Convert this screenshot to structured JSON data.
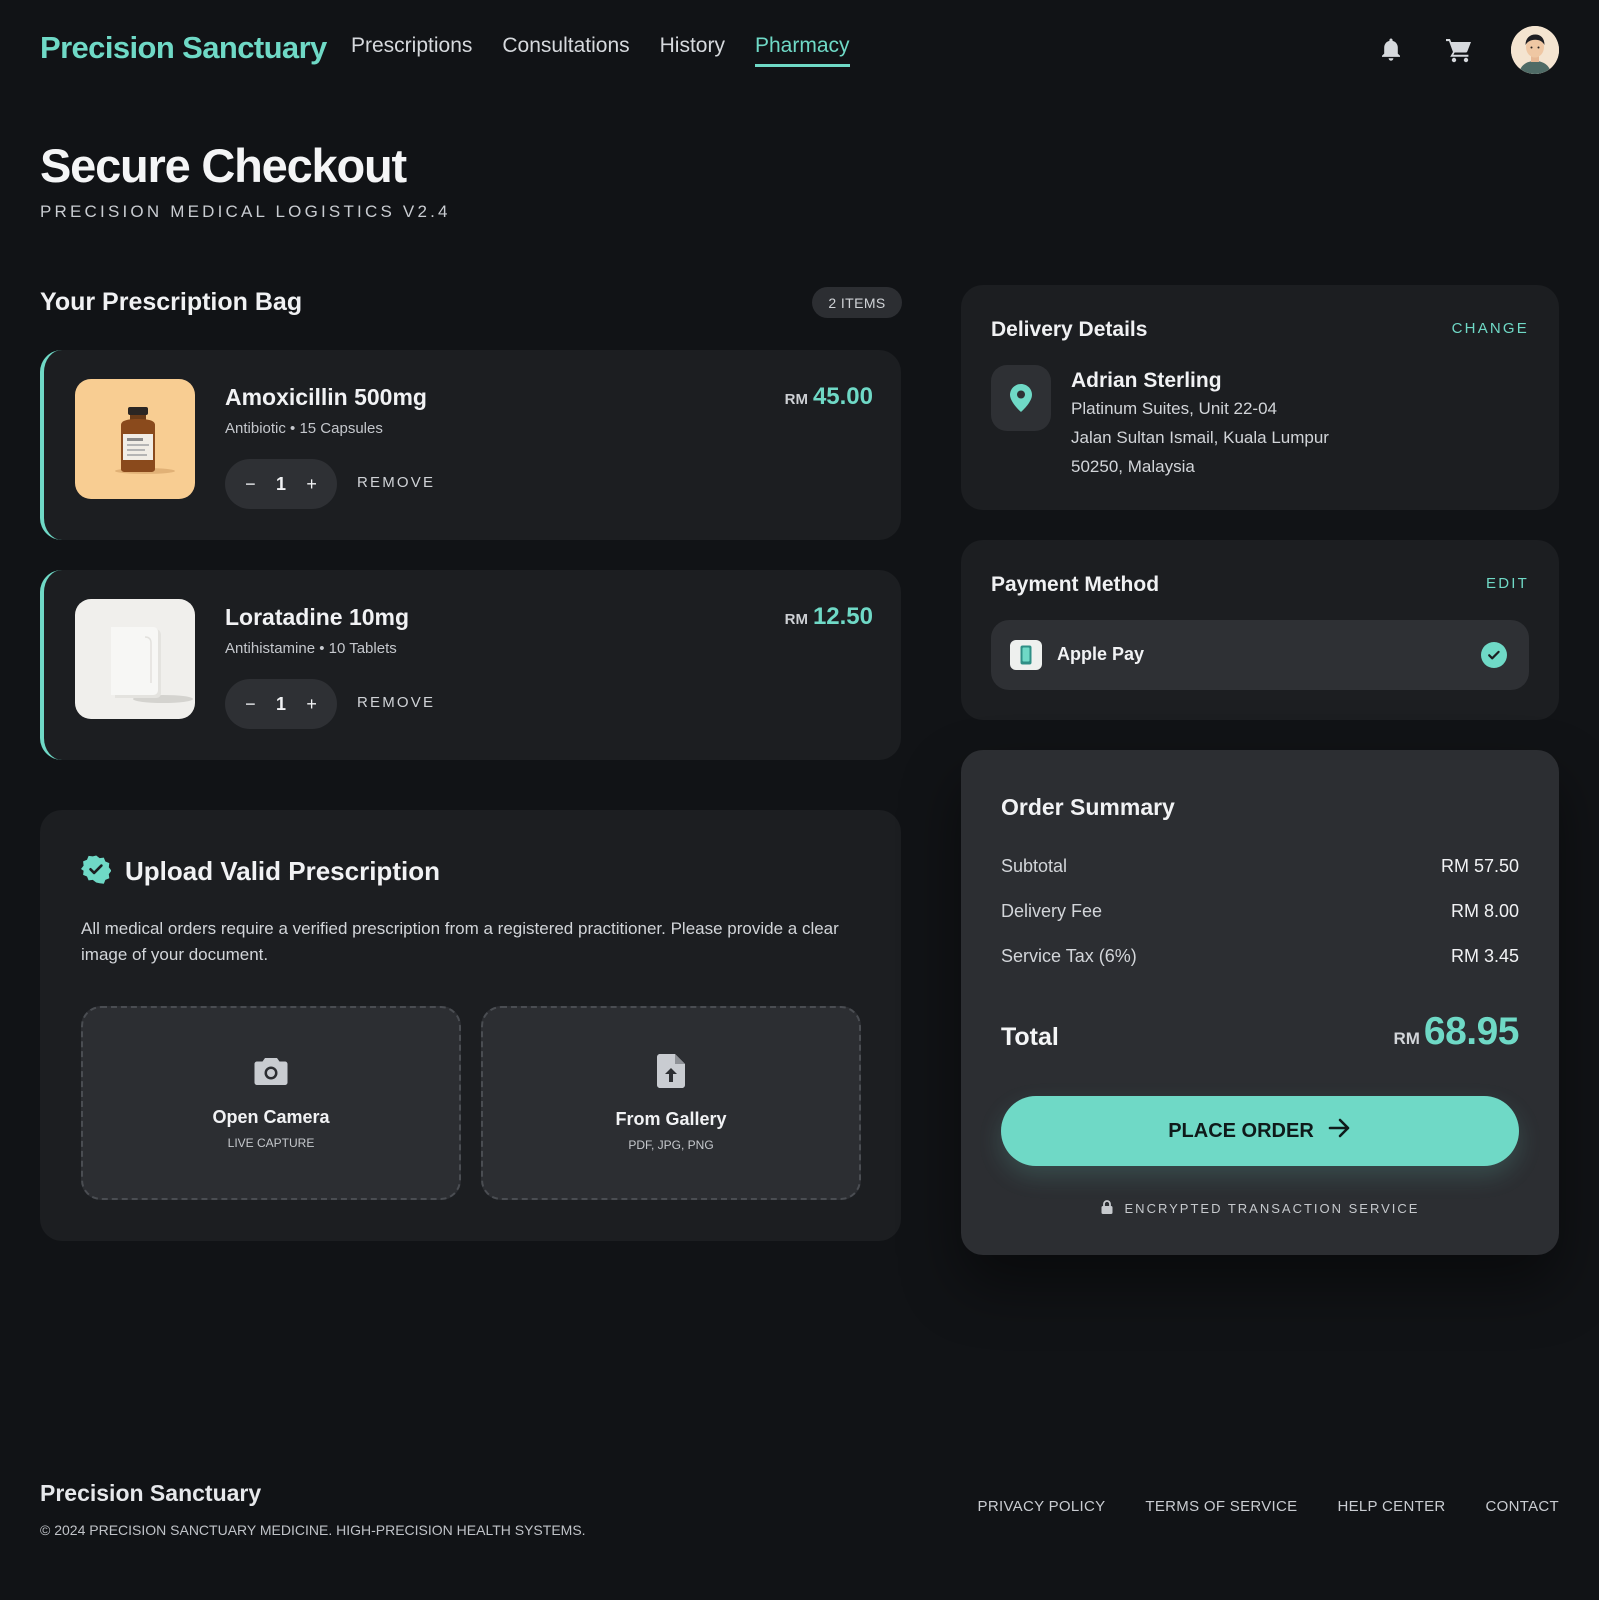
{
  "header": {
    "brand": "Precision Sanctuary",
    "nav": [
      {
        "label": "Prescriptions"
      },
      {
        "label": "Consultations"
      },
      {
        "label": "History"
      },
      {
        "label": "Pharmacy",
        "active": true
      }
    ],
    "icons": [
      "bell-icon",
      "cart-icon",
      "avatar"
    ]
  },
  "page": {
    "title": "Secure Checkout",
    "subtitle": "PRECISION MEDICAL LOGISTICS V2.4"
  },
  "bag": {
    "title": "Your Prescription Bag",
    "count_label": "2 ITEMS",
    "items": [
      {
        "name": "Amoxicillin 500mg",
        "meta": "Antibiotic • 15 Capsules",
        "currency": "RM",
        "price": "45.00",
        "qty": "1",
        "remove_label": "REMOVE",
        "minus": "−",
        "plus": "+"
      },
      {
        "name": "Loratadine 10mg",
        "meta": "Antihistamine • 10 Tablets",
        "currency": "RM",
        "price": "12.50",
        "qty": "1",
        "remove_label": "REMOVE",
        "minus": "−",
        "plus": "+"
      }
    ]
  },
  "upload": {
    "title": "Upload Valid Prescription",
    "description": "All medical orders require a verified prescription from a registered practitioner. Please provide a clear image of your document.",
    "options": [
      {
        "label": "Open Camera",
        "sub": "LIVE CAPTURE",
        "icon": "camera-icon"
      },
      {
        "label": "From Gallery",
        "sub": "PDF, JPG, PNG",
        "icon": "file-upload-icon"
      }
    ]
  },
  "delivery": {
    "title": "Delivery Details",
    "action": "CHANGE",
    "name": "Adrian Sterling",
    "lines": [
      "Platinum Suites, Unit 22-04",
      "Jalan Sultan Ismail, Kuala Lumpur",
      "50250, Malaysia"
    ]
  },
  "payment": {
    "title": "Payment Method",
    "action": "EDIT",
    "method": "Apple Pay"
  },
  "summary": {
    "title": "Order Summary",
    "rows": [
      {
        "label": "Subtotal",
        "value": "RM 57.50"
      },
      {
        "label": "Delivery Fee",
        "value": "RM 8.00"
      },
      {
        "label": "Service Tax (6%)",
        "value": "RM 3.45"
      }
    ],
    "total_label": "Total",
    "total_currency": "RM",
    "total_value": "68.95",
    "cta": "PLACE ORDER",
    "secure_note": "ENCRYPTED TRANSACTION SERVICE"
  },
  "footer": {
    "brand": "Precision Sanctuary",
    "copyright": "© 2024 PRECISION SANCTUARY MEDICINE. HIGH-PRECISION HEALTH SYSTEMS.",
    "links": [
      "PRIVACY POLICY",
      "TERMS OF SERVICE",
      "HELP CENTER",
      "CONTACT"
    ]
  },
  "colors": {
    "accent": "#6fd9c6",
    "background": "#111316",
    "card": "#1c1e21",
    "card_raised": "#2c2e32"
  }
}
